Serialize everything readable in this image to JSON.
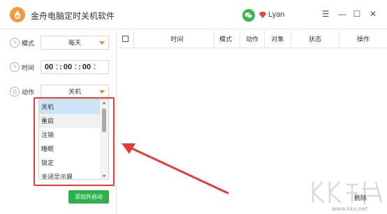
{
  "app": {
    "title": "金舟电脑定时关机软件",
    "user_name": "Lyan"
  },
  "window_controls": {
    "menu": "☰",
    "minimize": "—",
    "maximize": "☐",
    "close": "✕"
  },
  "form": {
    "mode_label": "模式",
    "mode_value": "每天",
    "time_label": "时间",
    "time_hours": "00",
    "time_minutes": "00",
    "time_seconds": "00",
    "action_label": "动作",
    "action_value": "关机"
  },
  "dropdown": {
    "options": [
      "关机",
      "重启",
      "注销",
      "睡眠",
      "锁定",
      "关闭显示屏"
    ]
  },
  "add_button_label": "添加并启动",
  "table": {
    "columns": [
      "时间",
      "模式",
      "动作",
      "对象",
      "状态",
      "操作"
    ]
  },
  "delete_label": "删除",
  "watermark": {
    "text": "www.kkx.net"
  },
  "colors": {
    "accent_orange": "#f08b24",
    "green": "#2db14b",
    "annotation_red": "#e83a3a",
    "highlight_blue": "#cde4f7"
  }
}
